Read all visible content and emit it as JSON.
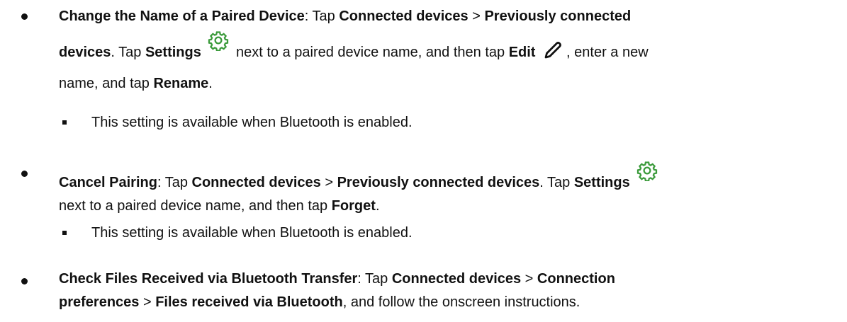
{
  "items": [
    {
      "title": "Change the Name of a Paired Device",
      "sep": ": Tap ",
      "b1": "Connected devices",
      "gt1": " > ",
      "b2a": "Previously connected",
      "b2b": "devices",
      "t1": ". Tap ",
      "b3": "Settings",
      "t2": " next to a paired device name, and then tap ",
      "b4": "Edit",
      "t3": ", enter a new",
      "t4": "name, and tap ",
      "b5": "Rename",
      "t5": ".",
      "note": "This setting is available when Bluetooth is enabled."
    },
    {
      "title": "Cancel Pairing",
      "sep": ": Tap ",
      "b1": "Connected devices",
      "gt1": " > ",
      "b2": "Previously connected devices",
      "t1": ". Tap ",
      "b3": "Settings",
      "t2": "next to a paired device name, and then tap ",
      "b4": "Forget",
      "t3": ".",
      "note": "This setting is available when Bluetooth is enabled."
    },
    {
      "title": "Check Files Received via Bluetooth Transfer",
      "sep": ": Tap ",
      "b1": "Connected devices",
      "gt1": " > ",
      "b2": "Connection",
      "b3": "preferences",
      "gt2": " > ",
      "b4": "Files received via Bluetooth",
      "t1": ", and follow the onscreen instructions."
    }
  ],
  "icons": {
    "settings": "gear-icon",
    "edit": "pencil-icon",
    "icon_color": "#3a9a3a"
  }
}
